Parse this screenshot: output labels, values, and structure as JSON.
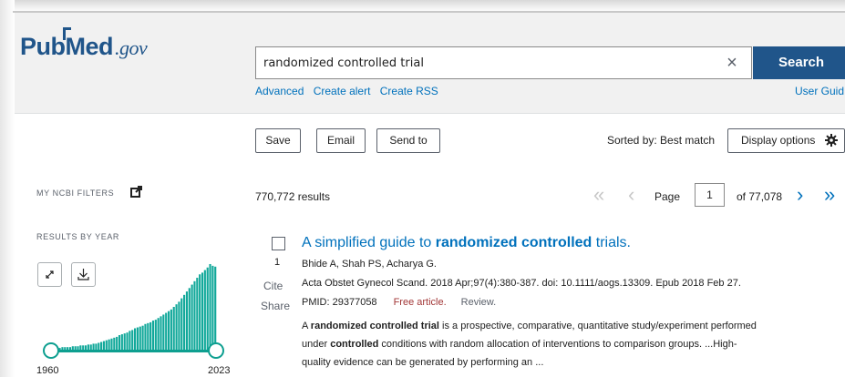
{
  "header": {
    "logo_pub": "Pub",
    "logo_med": "Med",
    "logo_gov": ".gov",
    "search_value": "randomized controlled trial",
    "clear_icon": "×",
    "search_button": "Search",
    "links": [
      "Advanced",
      "Create alert",
      "Create RSS"
    ],
    "user_guide": "User Guid"
  },
  "toolbar": {
    "save": "Save",
    "email": "Email",
    "send_to": "Send to",
    "sorted_by": "Sorted by: Best match",
    "display_options": "Display options"
  },
  "sidebar": {
    "my_ncbi_filters": "MY NCBI FILTERS",
    "results_by_year": "RESULTS BY YEAR",
    "year_start": "1960",
    "year_end": "2023",
    "bar_color": "#11a89a",
    "histogram_relative_heights": [
      0.02,
      0.02,
      0.02,
      0.02,
      0.03,
      0.03,
      0.03,
      0.03,
      0.04,
      0.04,
      0.04,
      0.05,
      0.05,
      0.05,
      0.06,
      0.06,
      0.07,
      0.07,
      0.08,
      0.09,
      0.1,
      0.11,
      0.12,
      0.13,
      0.14,
      0.15,
      0.17,
      0.18,
      0.19,
      0.2,
      0.22,
      0.23,
      0.25,
      0.26,
      0.27,
      0.28,
      0.3,
      0.31,
      0.32,
      0.34,
      0.35,
      0.37,
      0.39,
      0.41,
      0.43,
      0.45,
      0.47,
      0.5,
      0.53,
      0.56,
      0.6,
      0.64,
      0.68,
      0.72,
      0.76,
      0.8,
      0.84,
      0.88,
      0.9,
      0.93,
      0.96,
      1.0,
      0.98,
      0.97
    ]
  },
  "results": {
    "count": "770,772 results",
    "page_label": "Page",
    "page_value": "1",
    "page_of": "of 77,078",
    "items": [
      {
        "rank": "1",
        "title_pre": "A simplified guide to ",
        "title_bold": "randomized controlled",
        "title_post": " trials.",
        "authors": "Bhide A, Shah PS, Acharya G.",
        "citation": "Acta Obstet Gynecol Scand. 2018 Apr;97(4):380-387. doi: 10.1111/aogs.13309. Epub 2018 Feb 27.",
        "pmid": "PMID: 29377058",
        "free": "Free article.",
        "type": "Review.",
        "cite": "Cite",
        "share": "Share",
        "snip1_pre": "A ",
        "snip1_bold": "randomized controlled trial",
        "snip1_post": " is a prospective, comparative, quantitative study/experiment performed",
        "snip2_pre": "under ",
        "snip2_bold": "controlled",
        "snip2_post": " conditions with random allocation of interventions to comparison groups. ...High-",
        "snip3": "quality evidence can be generated by performing an ..."
      }
    ]
  }
}
